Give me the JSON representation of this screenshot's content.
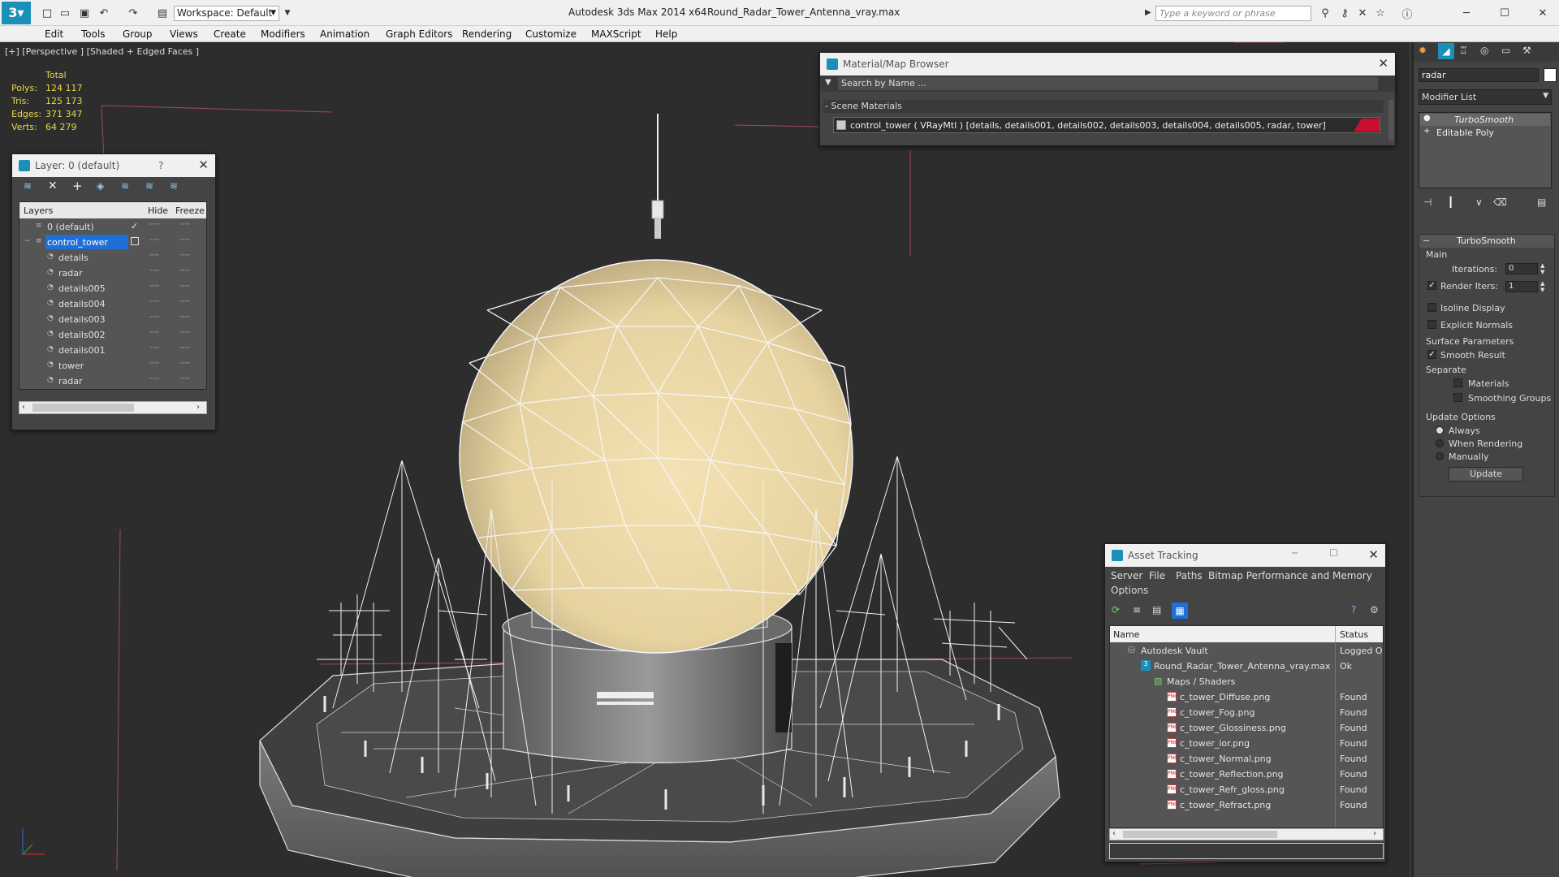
{
  "app": {
    "title": "Autodesk 3ds Max  2014 x64",
    "filename": "Round_Radar_Tower_Antenna_vray.max",
    "workspace": "Workspace: Default",
    "search_placeholder": "Type a keyword or phrase"
  },
  "menu": [
    "Edit",
    "Tools",
    "Group",
    "Views",
    "Create",
    "Modifiers",
    "Animation",
    "Graph Editors",
    "Rendering",
    "Customize",
    "MAXScript",
    "Help"
  ],
  "viewport": {
    "label": "[+] [Perspective ] [Shaded + Edged Faces ]",
    "stats": {
      "header": "Total",
      "rows": [
        {
          "label": "Polys:",
          "value": "124 117"
        },
        {
          "label": "Tris:",
          "value": "125 173"
        },
        {
          "label": "Edges:",
          "value": "371 347"
        },
        {
          "label": "Verts:",
          "value": "64 279"
        }
      ]
    }
  },
  "layer_panel": {
    "title": "Layer: 0 (default)",
    "help": "?",
    "columns": {
      "layers": "Layers",
      "hide": "Hide",
      "freeze": "Freeze"
    },
    "rows": [
      {
        "name": "0 (default)",
        "indent": 0
      },
      {
        "name": "control_tower",
        "indent": 0
      },
      {
        "name": "details",
        "indent": 1
      },
      {
        "name": "radar",
        "indent": 1
      },
      {
        "name": "details005",
        "indent": 1
      },
      {
        "name": "details004",
        "indent": 1
      },
      {
        "name": "details003",
        "indent": 1
      },
      {
        "name": "details002",
        "indent": 1
      },
      {
        "name": "details001",
        "indent": 1
      },
      {
        "name": "tower",
        "indent": 1
      },
      {
        "name": "radar",
        "indent": 1
      }
    ]
  },
  "material_browser": {
    "title": "Material/Map Browser",
    "search_placeholder": "Search by Name ...",
    "section": "- Scene Materials",
    "material": "control_tower  ( VRayMtl ) [details, details001, details002, details003, details004, details005, radar, tower]"
  },
  "command_panel": {
    "object_name": "radar",
    "modifier_list": "Modifier List",
    "stack": [
      "TurboSmooth",
      "Editable Poly"
    ],
    "rollout_title": "TurboSmooth",
    "main_label": "Main",
    "iterations_label": "Iterations:",
    "iterations_value": "0",
    "render_iters_label": "Render Iters:",
    "render_iters_value": "1",
    "isoline": "Isoline Display",
    "explicit": "Explicit Normals",
    "surface_params": "Surface Parameters",
    "smooth_result": "Smooth Result",
    "separate": "Separate",
    "materials": "Materials",
    "smoothing_groups": "Smoothing Groups",
    "update_options": "Update Options",
    "always": "Always",
    "when_rendering": "When Rendering",
    "manually": "Manually",
    "update_button": "Update"
  },
  "asset_tracking": {
    "title": "Asset Tracking",
    "menu": [
      "Server",
      "File",
      "Paths",
      "Bitmap Performance and Memory",
      "Options"
    ],
    "columns": {
      "name": "Name",
      "status": "Status"
    },
    "rows": [
      {
        "name": "Autodesk Vault",
        "status": "Logged O",
        "indent": 1,
        "icon": "vault"
      },
      {
        "name": "Round_Radar_Tower_Antenna_vray.max",
        "status": "Ok",
        "indent": 2,
        "icon": "max"
      },
      {
        "name": "Maps / Shaders",
        "status": "",
        "indent": 3,
        "icon": "maps"
      },
      {
        "name": "c_tower_Diffuse.png",
        "status": "Found",
        "indent": 4,
        "icon": "png"
      },
      {
        "name": "c_tower_Fog.png",
        "status": "Found",
        "indent": 4,
        "icon": "png"
      },
      {
        "name": "c_tower_Glossiness.png",
        "status": "Found",
        "indent": 4,
        "icon": "png"
      },
      {
        "name": "c_tower_ior.png",
        "status": "Found",
        "indent": 4,
        "icon": "png"
      },
      {
        "name": "c_tower_Normal.png",
        "status": "Found",
        "indent": 4,
        "icon": "png"
      },
      {
        "name": "c_tower_Reflection.png",
        "status": "Found",
        "indent": 4,
        "icon": "png"
      },
      {
        "name": "c_tower_Refr_gloss.png",
        "status": "Found",
        "indent": 4,
        "icon": "png"
      },
      {
        "name": "c_tower_Refract.png",
        "status": "Found",
        "indent": 4,
        "icon": "png"
      }
    ]
  },
  "colors": {
    "accent": "#1a8fb8",
    "selection": "#1e6fd6",
    "stats": "#e6d84a",
    "material_swatch": "#c8102e"
  }
}
